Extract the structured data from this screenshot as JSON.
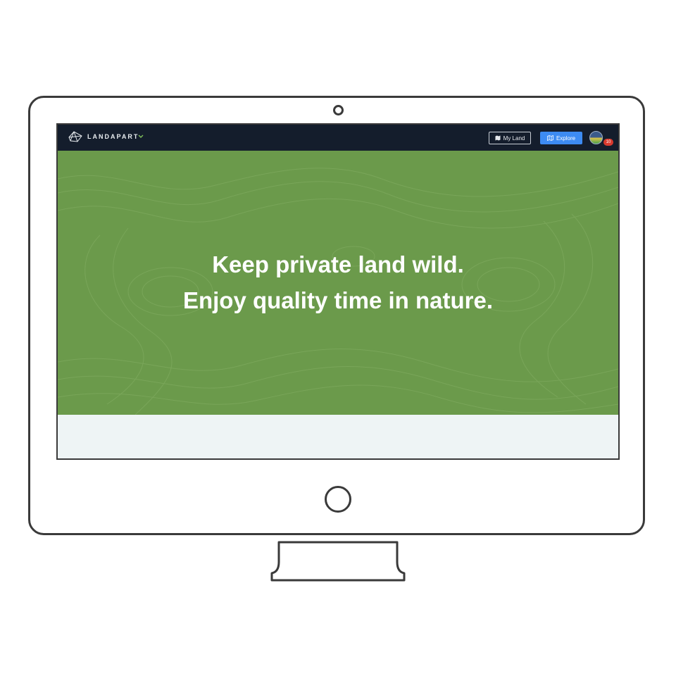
{
  "app": {
    "brand": "LANDAPART"
  },
  "navbar": {
    "my_land_label": "My Land",
    "explore_label": "Explore",
    "notification_count": "10",
    "colors": {
      "background": "#141d2c",
      "explore_button": "#3d8bf2",
      "badge": "#d83a2e",
      "chevron": "#7fbf5a"
    },
    "icons": {
      "logo": "polygon-logo-icon",
      "dropdown": "chevron-down-icon",
      "my_land": "map-icon",
      "explore": "map-outline-icon"
    }
  },
  "hero": {
    "line1": "Keep private land wild.",
    "line2": "Enjoy quality time in nature.",
    "background_color": "#6b9a4b"
  },
  "section_below": {
    "background_color": "#eef4f5"
  }
}
